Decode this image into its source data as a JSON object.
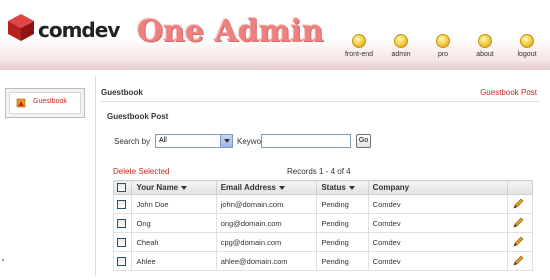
{
  "header": {
    "brand": "comdev",
    "title": "One Admin",
    "nav": [
      {
        "label": "front-end"
      },
      {
        "label": "admin"
      },
      {
        "label": "pro"
      },
      {
        "label": "about"
      },
      {
        "label": "logout"
      }
    ],
    "colors": {
      "title": "#ee8080",
      "accent": "#cc2222",
      "bulb": "#f7d24a"
    }
  },
  "sidebar": {
    "items": [
      {
        "label": "Guestbook",
        "icon": "guestbook-icon"
      }
    ]
  },
  "main": {
    "breadcrumb": "Guestbook",
    "header_link": "Guestbook Post",
    "section_title": "Guestbook Post",
    "search": {
      "search_by_label": "Search by",
      "search_by_value": "All",
      "keywords_label": "Keywords",
      "keywords_value": "",
      "go_label": "Go"
    },
    "delete_selected": "Delete Selected",
    "records": "Records 1 - 4 of 4",
    "table": {
      "columns": [
        "Your Name",
        "Email Address",
        "Status",
        "Company"
      ],
      "rows": [
        {
          "name": "John Doe",
          "email": "john@domain.com",
          "status": "Pending",
          "company": "Comdev"
        },
        {
          "name": "Ong",
          "email": "ong@domain.com",
          "status": "Pending",
          "company": "Comdev"
        },
        {
          "name": "Cheah",
          "email": "cpg@domain.com",
          "status": "Pending",
          "company": "Comdev"
        },
        {
          "name": "Ahlee",
          "email": "ahlee@domain.com",
          "status": "Pending",
          "company": "Comdev"
        }
      ]
    }
  }
}
